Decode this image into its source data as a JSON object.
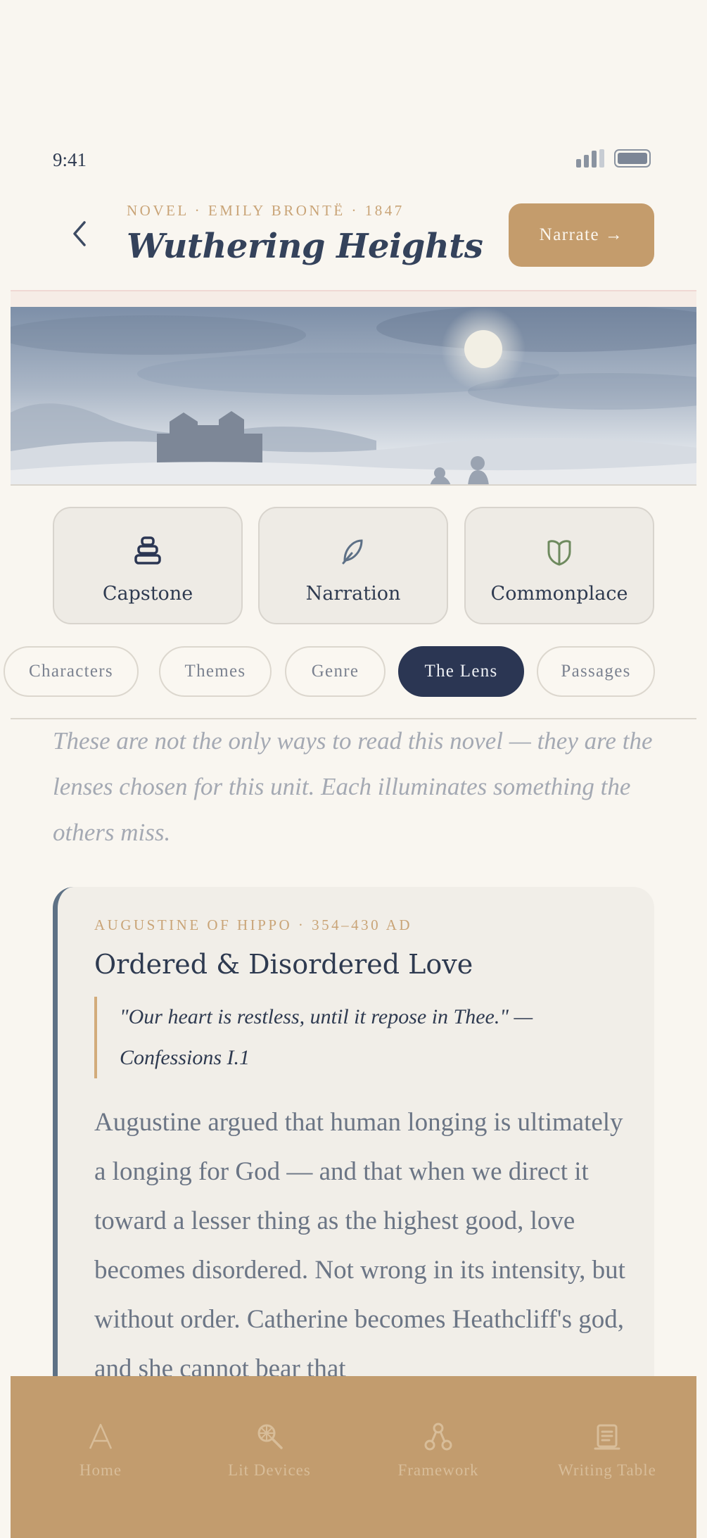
{
  "status_bar": {
    "time": "9:41"
  },
  "header": {
    "eyebrow": "NOVEL · EMILY BRONTË · 1847",
    "title": "Wuthering Heights",
    "narrate_label": "Narrate →"
  },
  "feature_cards": [
    {
      "label": "Capstone",
      "icon": "stack-icon"
    },
    {
      "label": "Narration",
      "icon": "quill-icon"
    },
    {
      "label": "Commonplace",
      "icon": "open-book-icon"
    }
  ],
  "tabs": [
    {
      "label": "Characters",
      "active": false
    },
    {
      "label": "Themes",
      "active": false
    },
    {
      "label": "Genre",
      "active": false
    },
    {
      "label": "The Lens",
      "active": true
    },
    {
      "label": "Passages",
      "active": false
    }
  ],
  "intro": "These are not the only ways to read this novel — they are the lenses chosen for this unit. Each illuminates something the others miss.",
  "lens_card": {
    "eyebrow": "AUGUSTINE OF HIPPO · 354–430 AD",
    "title": "Ordered & Disordered Love",
    "quote": "\"Our heart is restless, until it repose in Thee.\" — Confessions I.1",
    "body": "Augustine argued that human longing is ultimately a longing for God — and that when we direct it toward a lesser thing as the highest good, love becomes disordered. Not wrong in its intensity, but without order. Catherine becomes Heathcliff's god, and she cannot bear that"
  },
  "bottom_nav": [
    {
      "label": "Home",
      "icon": "letter-a-icon"
    },
    {
      "label": "Lit Devices",
      "icon": "magnifier-icon"
    },
    {
      "label": "Framework",
      "icon": "nodes-icon"
    },
    {
      "label": "Writing Table",
      "icon": "notepad-icon"
    }
  ],
  "colors": {
    "background": "#f9f6f0",
    "accent": "#c49c6c",
    "navy": "#2b3653",
    "nav_bar": "#c29c6e"
  }
}
